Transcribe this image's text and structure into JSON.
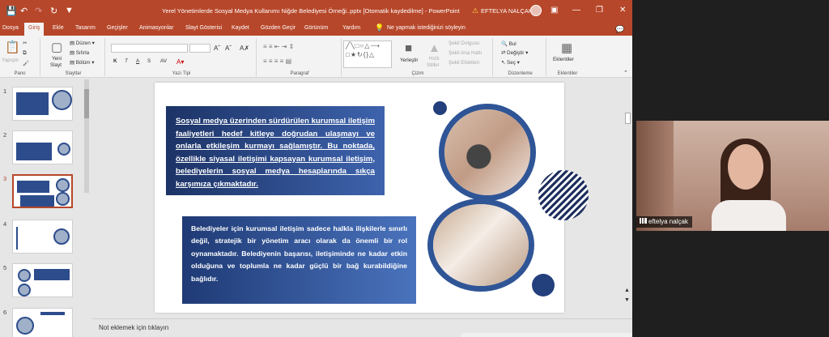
{
  "titlebar": {
    "doc_title": "Yerel Yönetimlerde Sosyal Medya Kullanımı Niğde Belediyesi Örneği..pptx [Otomatik kaydedilme]  -  PowerPoint",
    "user": "EFTELYA NALÇAK"
  },
  "tabs": [
    "Dosya",
    "Giriş",
    "Ekle",
    "Tasarım",
    "Geçişler",
    "Animasyonlar",
    "Slayt Gösterisi",
    "Kaydet",
    "Gözden Geçir",
    "Görünüm",
    "Yardım"
  ],
  "tell_me": "Ne yapmak istediğinizi söyleyin",
  "ribbon": {
    "pano": {
      "paste": "Yapıştır",
      "label": "Pano"
    },
    "slaytlar": {
      "new_slide_1": "Yeni",
      "new_slide_2": "Slayt",
      "layout": "Düzen",
      "reset": "Sıfırla",
      "section": "Bölüm",
      "label": "Slaytlar"
    },
    "font": {
      "size": "",
      "label": "Yazı Tipi",
      "buttons": [
        "K",
        "T",
        "A",
        "S",
        "AV"
      ]
    },
    "paragraph": {
      "label": "Paragraf"
    },
    "drawing": {
      "arrange_1": "Yerleştir",
      "quick_1": "Hızlı",
      "quick_2": "Stiller",
      "fill": "Şekil Dolgusu",
      "outline": "Şekil Ana Hattı",
      "effects": "Şekil Efektleri",
      "label": "Çizim"
    },
    "editing": {
      "find": "Bul",
      "replace": "Değiştir",
      "select": "Seç",
      "label": "Düzenleme"
    },
    "addins": {
      "addins": "Eklentiler",
      "label": "Eklentiler"
    }
  },
  "slides": [
    {
      "num": "1"
    },
    {
      "num": "2"
    },
    {
      "num": "3"
    },
    {
      "num": "4"
    },
    {
      "num": "5"
    },
    {
      "num": "6"
    }
  ],
  "slide": {
    "box1_text": "Sosyal medya üzerinden sürdürülen kurumsal iletişim faaliyetleri hedef kitleye doğrudan ulaşmayı ve onlarla etkileşim kurmayı sağlamıştır. Bu noktada, özellikle siyasal iletişimi kapsayan kurumsal iletişim, belediyelerin sosyal medya hesaplarında sıkça karşımıza çıkmaktadır.",
    "box2_text": "Belediyeler için kurumsal iletişim sadece halkla ilişkilerle sınırlı değil, stratejik bir yönetim aracı olarak da önemli bir rol oynamaktadır. Belediyenin başarısı, iletişiminde ne kadar etkin olduğuna ve toplumla ne kadar güçlü bir bağ kurabildiğine bağlıdır."
  },
  "notes_placeholder": "Not eklemek için tıklayın",
  "video": {
    "participant": "eftelya nalçak"
  },
  "colors": {
    "accent": "#b7472a",
    "slide_blue": "#2f5596"
  }
}
